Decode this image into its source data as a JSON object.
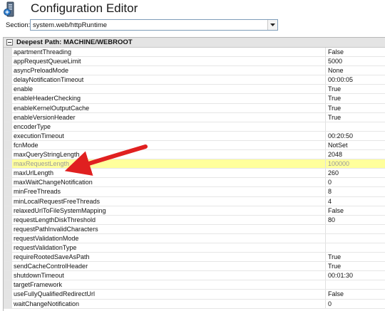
{
  "window": {
    "title": "Configuration Editor",
    "icon": "configuration-editor-icon"
  },
  "section": {
    "label": "Section:",
    "value": "system.web/httpRuntime"
  },
  "grid": {
    "group_title": "Deepest Path: MACHINE/WEBROOT",
    "highlight_color": "#ffff9c",
    "annotation_arrow_color": "#e02020",
    "properties": [
      {
        "name": "apartmentThreading",
        "value": "False"
      },
      {
        "name": "appRequestQueueLimit",
        "value": "5000"
      },
      {
        "name": "asyncPreloadMode",
        "value": "None"
      },
      {
        "name": "delayNotificationTimeout",
        "value": "00:00:05"
      },
      {
        "name": "enable",
        "value": "True"
      },
      {
        "name": "enableHeaderChecking",
        "value": "True"
      },
      {
        "name": "enableKernelOutputCache",
        "value": "True"
      },
      {
        "name": "enableVersionHeader",
        "value": "True"
      },
      {
        "name": "encoderType",
        "value": ""
      },
      {
        "name": "executionTimeout",
        "value": "00:20:50"
      },
      {
        "name": "fcnMode",
        "value": "NotSet"
      },
      {
        "name": "maxQueryStringLength",
        "value": "2048"
      },
      {
        "name": "maxRequestLength",
        "value": "100000",
        "highlighted": true
      },
      {
        "name": "maxUrlLength",
        "value": "260"
      },
      {
        "name": "maxWaitChangeNotification",
        "value": "0"
      },
      {
        "name": "minFreeThreads",
        "value": "8"
      },
      {
        "name": "minLocalRequestFreeThreads",
        "value": "4"
      },
      {
        "name": "relaxedUrlToFileSystemMapping",
        "value": "False"
      },
      {
        "name": "requestLengthDiskThreshold",
        "value": "80"
      },
      {
        "name": "requestPathInvalidCharacters",
        "value": ""
      },
      {
        "name": "requestValidationMode",
        "value": ""
      },
      {
        "name": "requestValidationType",
        "value": ""
      },
      {
        "name": "requireRootedSaveAsPath",
        "value": "True"
      },
      {
        "name": "sendCacheControlHeader",
        "value": "True"
      },
      {
        "name": "shutdownTimeout",
        "value": "00:01:30"
      },
      {
        "name": "targetFramework",
        "value": ""
      },
      {
        "name": "useFullyQualifiedRedirectUrl",
        "value": "False"
      },
      {
        "name": "waitChangeNotification",
        "value": "0"
      }
    ]
  }
}
